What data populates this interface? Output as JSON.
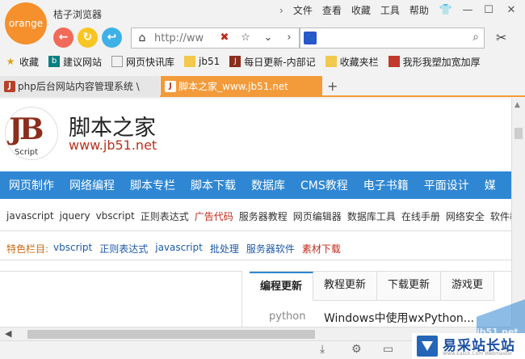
{
  "app": {
    "logo_text": "orange",
    "title": "桔子浏览器"
  },
  "menu": [
    "文件",
    "查看",
    "收藏",
    "工具",
    "帮助"
  ],
  "nav": {
    "address_placeholder": "http://ww"
  },
  "bookmarks": [
    {
      "label": "收藏",
      "icon": "star-icon"
    },
    {
      "label": "建议网站",
      "icon": "bing-icon"
    },
    {
      "label": "网页快讯库",
      "icon": "page-icon"
    },
    {
      "label": "jb51",
      "icon": "folder-icon"
    },
    {
      "label": "每日更新-内部记",
      "icon": "jb-icon"
    },
    {
      "label": "收藏夹栏",
      "icon": "folder-icon"
    },
    {
      "label": "我形我塑加宽加厚",
      "icon": "site-icon"
    }
  ],
  "tabs": [
    {
      "label": "php后台网站内容管理系统 \\"
    },
    {
      "label": "脚本之家_www.jb51.net"
    }
  ],
  "site": {
    "name": "脚本之家",
    "url": "www.jb51.net",
    "logo_sub": "Script",
    "main_nav": [
      "网页制作",
      "网络编程",
      "脚本专栏",
      "脚本下载",
      "数据库",
      "CMS教程",
      "电子书籍",
      "平面设计",
      "媒"
    ],
    "sub_nav": [
      "javascript",
      "jquery",
      "vbscript",
      "正则表达式",
      "广告代码",
      "服务器教程",
      "网页编辑器",
      "数据库工具",
      "在线手册",
      "网络安全",
      "软件教"
    ],
    "featured_label": "特色栏目:",
    "featured": [
      "vbscript",
      "正则表达式",
      "javascript",
      "批处理",
      "服务器软件",
      "素材下载"
    ],
    "content_tabs": [
      "编程更新",
      "教程更新",
      "下载更新",
      "游戏更"
    ],
    "article": {
      "category": "python",
      "title": "Windows中使用wxPython..."
    }
  },
  "watermark": {
    "brand": "易采站长站",
    "sub": "Www.Easck.Com Webmaster",
    "url": "jb51.net"
  }
}
